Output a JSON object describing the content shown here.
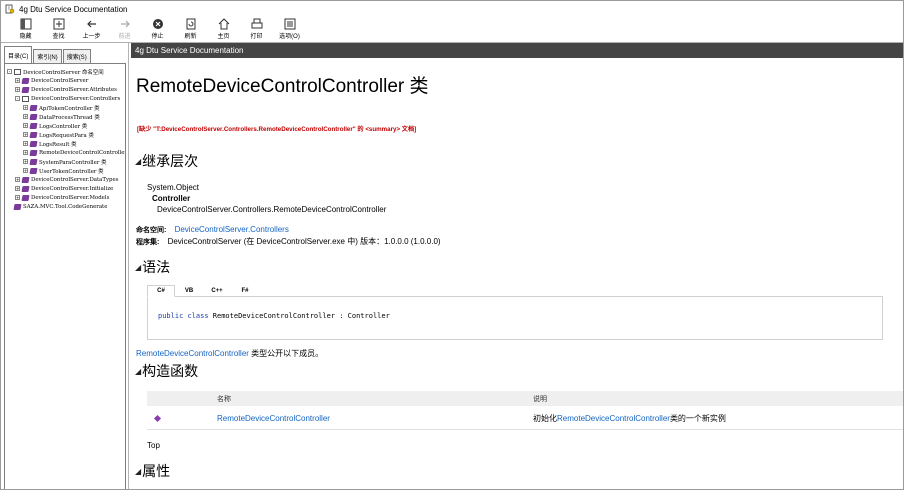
{
  "window": {
    "title": "4g Dtu Service Documentation"
  },
  "toolbar": {
    "buttons": [
      {
        "label": "隐藏",
        "icon": "hide-icon",
        "disabled": false
      },
      {
        "label": "查找",
        "icon": "locate-icon",
        "disabled": false
      },
      {
        "label": "上一步",
        "icon": "back-arrow-icon",
        "disabled": false
      },
      {
        "label": "前进",
        "icon": "forward-arrow-icon",
        "disabled": true
      },
      {
        "label": "停止",
        "icon": "stop-icon",
        "disabled": false
      },
      {
        "label": "刷新",
        "icon": "refresh-icon",
        "disabled": false
      },
      {
        "label": "主页",
        "icon": "home-icon",
        "disabled": false
      },
      {
        "label": "打印",
        "icon": "print-icon",
        "disabled": false
      },
      {
        "label": "选项(O)",
        "icon": "options-icon",
        "disabled": false
      }
    ]
  },
  "nav": {
    "tabs": [
      {
        "label": "目录(C)",
        "active": true
      },
      {
        "label": "索引(N)",
        "active": false
      },
      {
        "label": "搜索(S)",
        "active": false
      }
    ],
    "tree": [
      {
        "indent": 0,
        "expander": "-",
        "icon": "book",
        "label": "DeviceControlServer 命名空间"
      },
      {
        "indent": 1,
        "expander": "+",
        "icon": "cls",
        "label": "DeviceControlServer"
      },
      {
        "indent": 1,
        "expander": "+",
        "icon": "cls",
        "label": "DeviceControlServer.Attributes"
      },
      {
        "indent": 1,
        "expander": "-",
        "icon": "book",
        "label": "DeviceControlServer.Controllers"
      },
      {
        "indent": 2,
        "expander": "+",
        "icon": "cls",
        "label": "ApiTokenController 类"
      },
      {
        "indent": 2,
        "expander": "+",
        "icon": "cls",
        "label": "DataProcessThread 类"
      },
      {
        "indent": 2,
        "expander": "+",
        "icon": "cls",
        "label": "LogsController 类"
      },
      {
        "indent": 2,
        "expander": "+",
        "icon": "cls",
        "label": "LogsRequestPara 类"
      },
      {
        "indent": 2,
        "expander": "+",
        "icon": "cls",
        "label": "LogsResult 类"
      },
      {
        "indent": 2,
        "expander": "+",
        "icon": "cls",
        "label": "RemoteDeviceControlController"
      },
      {
        "indent": 2,
        "expander": "+",
        "icon": "cls",
        "label": "SystemParaController 类"
      },
      {
        "indent": 2,
        "expander": "+",
        "icon": "cls",
        "label": "UserTokenController 类"
      },
      {
        "indent": 1,
        "expander": "+",
        "icon": "cls",
        "label": "DeviceControlServer.DataTypes"
      },
      {
        "indent": 1,
        "expander": "+",
        "icon": "cls",
        "label": "DeviceControlServer.Initialize"
      },
      {
        "indent": 1,
        "expander": "+",
        "icon": "cls",
        "label": "DeviceControlServer.Models"
      },
      {
        "indent": 0,
        "expander": "",
        "icon": "cls",
        "label": "SAZA.MVC.Tool.CodeGenerate"
      }
    ]
  },
  "topic": {
    "bar_title": "4g Dtu Service Documentation",
    "title": "RemoteDeviceControlController 类",
    "missing_summary": "[缺少 \"T:DeviceControlServer.Controllers.RemoteDeviceControlController\" 的 <summary> 文档]",
    "inheritance": {
      "heading": "继承层次",
      "base": "System.Object",
      "parent": "Controller",
      "current": "DeviceControlServer.Controllers.RemoteDeviceControlController"
    },
    "namespace_label": "命名空间:",
    "namespace_value": "DeviceControlServer.Controllers",
    "assembly_label": "程序集:",
    "assembly_value": "DeviceControlServer (在 DeviceControlServer.exe 中) 版本：1.0.0.0 (1.0.0.0)",
    "syntax": {
      "heading": "语法",
      "tabs": [
        "C#",
        "VB",
        "C++",
        "F#"
      ],
      "code_keywords": "public class",
      "code_rest": " RemoteDeviceControlController : Controller"
    },
    "exposed_link": "RemoteDeviceControlController",
    "exposed_text": " 类型公开以下成员。",
    "constructors": {
      "heading": "构造函数",
      "col_name": "名称",
      "col_desc": "说明",
      "row_name": "RemoteDeviceControlController",
      "row_desc_prefix": "初始化 ",
      "row_desc_link": "RemoteDeviceControlController",
      "row_desc_suffix": " 类的一个新实例"
    },
    "top_link": "Top",
    "properties_heading": "属性"
  }
}
